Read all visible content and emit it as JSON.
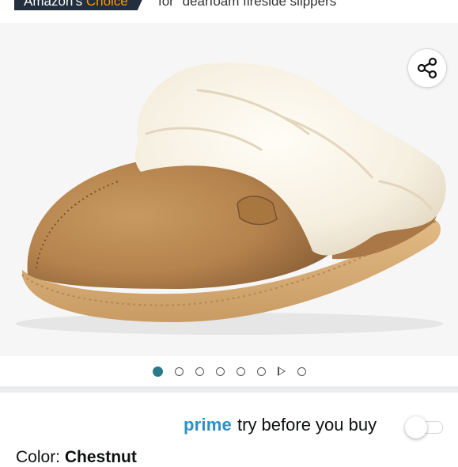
{
  "badge": {
    "prefix": "Amazon's",
    "highlight": "Choice",
    "for_text": "for \"dearfoam fireside slippers\""
  },
  "product_image": {
    "alt": "shearling-trimmed chestnut suede slipper"
  },
  "share": {
    "icon": "share-icon"
  },
  "carousel": {
    "dots": [
      {
        "type": "dot",
        "active": true
      },
      {
        "type": "dot",
        "active": false
      },
      {
        "type": "dot",
        "active": false
      },
      {
        "type": "dot",
        "active": false
      },
      {
        "type": "dot",
        "active": false
      },
      {
        "type": "dot",
        "active": false
      },
      {
        "type": "video",
        "active": false
      },
      {
        "type": "dot",
        "active": false
      }
    ]
  },
  "prime": {
    "prime_word": "prime",
    "tail": "try before you buy",
    "toggle_on": false
  },
  "color": {
    "label": "Color: ",
    "value": "Chestnut"
  },
  "colors": {
    "prime_blue": "#2f8fc7",
    "active_dot": "#2b7a8c",
    "badge_bg": "#232f3e",
    "badge_accent": "#ff9900"
  }
}
